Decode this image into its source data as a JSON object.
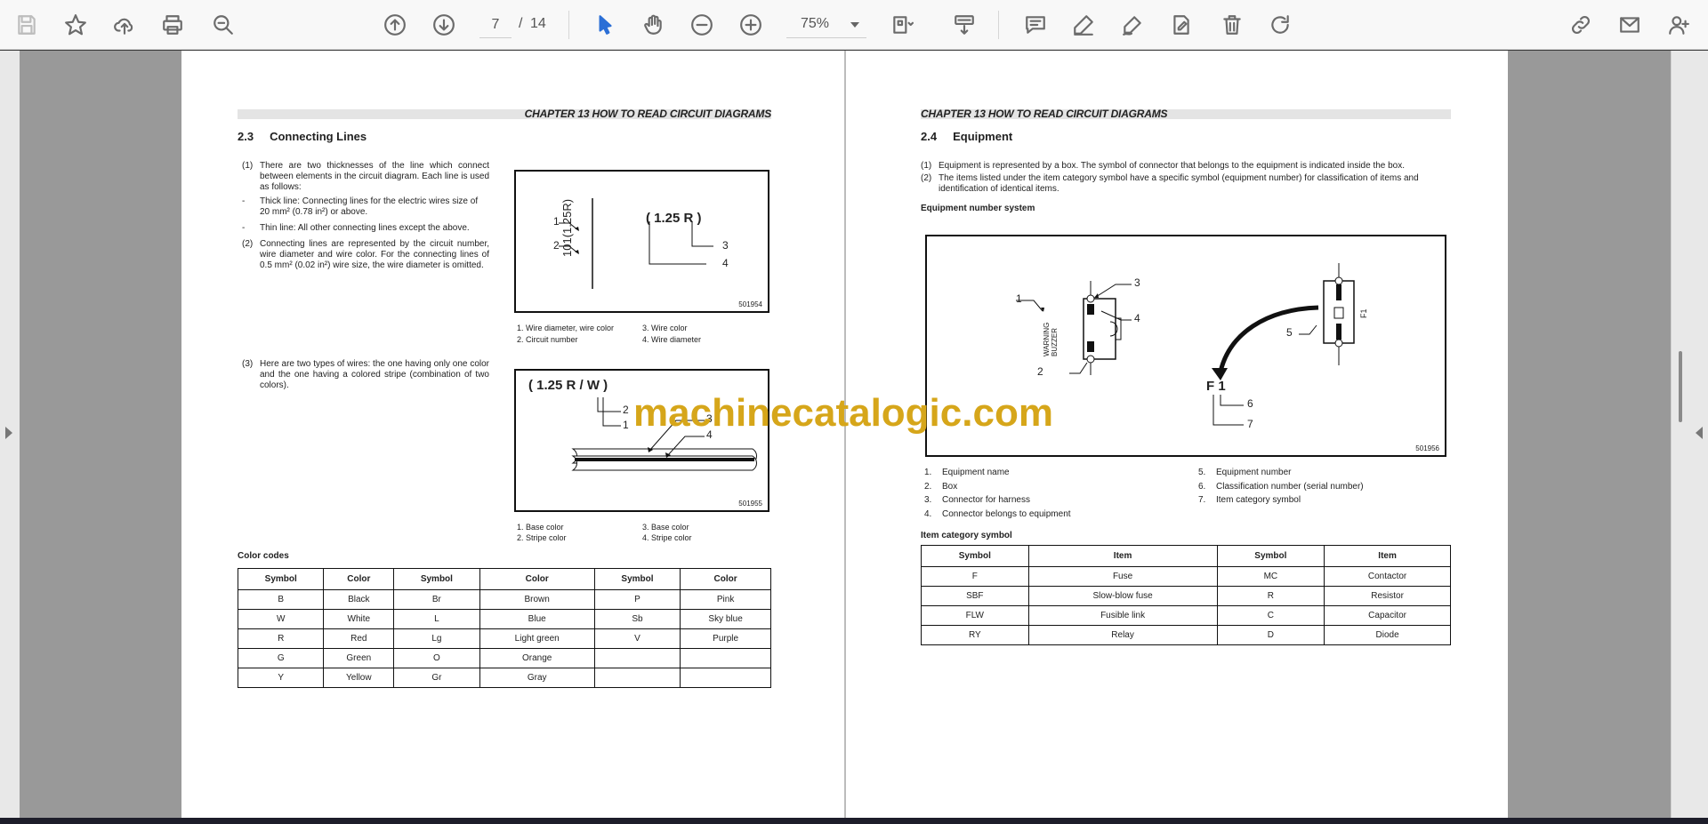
{
  "toolbar": {
    "page_current": "7",
    "page_total": "14",
    "page_slash": "/",
    "zoom": "75%"
  },
  "left_page": {
    "chapter": "CHAPTER 13 HOW TO READ CIRCUIT DIAGRAMS",
    "section_num": "2.3",
    "section_title": "Connecting Lines",
    "p1_mark": "(1)",
    "p1_text": "There are two thicknesses of the line which connect between elements in the circuit diagram. Each line is used as follows:",
    "p1a_mark": "-",
    "p1a_text": "Thick line: Connecting lines for the electric wires size of 20 mm² (0.78 in²) or above.",
    "p1b_mark": "-",
    "p1b_text": "Thin line: All other connecting lines except the above.",
    "p2_mark": "(2)",
    "p2_text": "Connecting lines are represented by the circuit number, wire diameter and wire color. For the connecting lines of 0.5 mm² (0.02 in²) wire size, the wire diameter is omitted.",
    "p3_mark": "(3)",
    "p3_text": "Here are two types of wires: the one having only one color and the one having a colored stripe (combination of two colors).",
    "fig1": {
      "code": "501954",
      "wire_label": "101(1.25R)",
      "spec": "( 1.25 R )",
      "callouts": [
        "1",
        "2",
        "3",
        "4"
      ],
      "legend": [
        "1. Wire diameter, wire color",
        "2. Circuit number",
        "3. Wire color",
        "4. Wire diameter"
      ]
    },
    "fig2": {
      "code": "501955",
      "spec": "( 1.25 R / W )",
      "callouts": [
        "1",
        "2",
        "3",
        "4"
      ],
      "legend": [
        "1. Base color",
        "2. Stripe color",
        "3. Base color",
        "4. Stripe color"
      ]
    },
    "color_codes_title": "Color codes",
    "color_table": {
      "headers": [
        "Symbol",
        "Color",
        "Symbol",
        "Color",
        "Symbol",
        "Color"
      ],
      "rows": [
        [
          "B",
          "Black",
          "Br",
          "Brown",
          "P",
          "Pink"
        ],
        [
          "W",
          "White",
          "L",
          "Blue",
          "Sb",
          "Sky blue"
        ],
        [
          "R",
          "Red",
          "Lg",
          "Light green",
          "V",
          "Purple"
        ],
        [
          "G",
          "Green",
          "O",
          "Orange",
          "",
          ""
        ],
        [
          "Y",
          "Yellow",
          "Gr",
          "Gray",
          "",
          ""
        ]
      ]
    }
  },
  "right_page": {
    "chapter": "CHAPTER 13 HOW TO READ CIRCUIT DIAGRAMS",
    "section_num": "2.4",
    "section_title": "Equipment",
    "p1_mark": "(1)",
    "p1_text": "Equipment is represented by a box. The symbol of connector that belongs to the equipment is indicated inside the box.",
    "p2_mark": "(2)",
    "p2_text": "The items listed under the item category symbol have a specific symbol (equipment number) for classification of items and identification of identical items.",
    "eq_num_title": "Equipment number system",
    "fig3": {
      "code": "501956",
      "buzzer_label": "WARNING BUZZER",
      "fuse_label": "F1",
      "fuse_text": "F 1",
      "callouts": [
        "1",
        "2",
        "3",
        "4",
        "5",
        "6",
        "7"
      ]
    },
    "legend_left": [
      {
        "n": "1.",
        "t": "Equipment name"
      },
      {
        "n": "2.",
        "t": "Box"
      },
      {
        "n": "3.",
        "t": "Connector for harness"
      },
      {
        "n": "4.",
        "t": "Connector belongs to equipment"
      }
    ],
    "legend_right": [
      {
        "n": "5.",
        "t": "Equipment number"
      },
      {
        "n": "6.",
        "t": "Classification number (serial number)"
      },
      {
        "n": "7.",
        "t": "Item category symbol"
      }
    ],
    "item_cat_title": "Item category symbol",
    "item_table": {
      "headers": [
        "Symbol",
        "Item",
        "Symbol",
        "Item"
      ],
      "rows": [
        [
          "F",
          "Fuse",
          "MC",
          "Contactor"
        ],
        [
          "SBF",
          "Slow-blow fuse",
          "R",
          "Resistor"
        ],
        [
          "FLW",
          "Fusible link",
          "C",
          "Capacitor"
        ],
        [
          "RY",
          "Relay",
          "D",
          "Diode"
        ]
      ]
    }
  },
  "watermark": "machinecatalogic.com"
}
